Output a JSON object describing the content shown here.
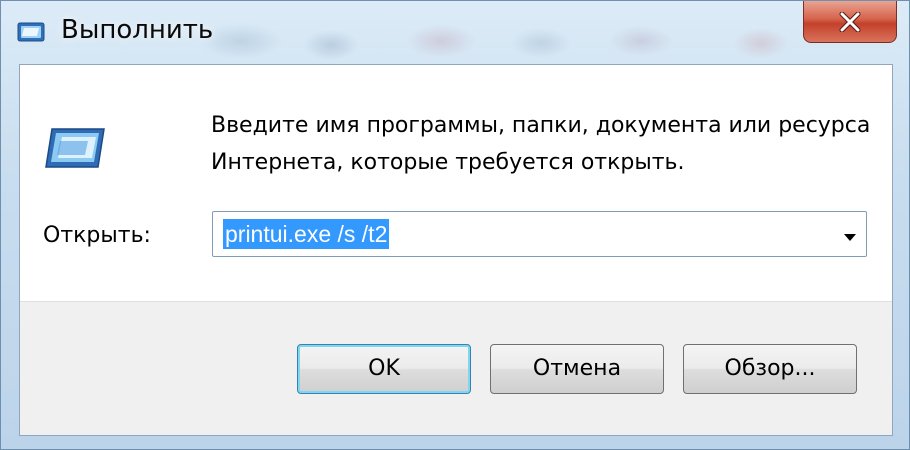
{
  "window": {
    "title": "Выполнить",
    "title_icon": "run-icon",
    "close_icon": "close-icon"
  },
  "dialog": {
    "icon": "run-icon",
    "prompt_lines": [
      "Введите имя программы, папки, документа или ресурса",
      "Интернета, которые требуется открыть."
    ],
    "open_label": "Открыть:",
    "open_value": "printui.exe /s /t2",
    "dropdown_icon": "chevron-down-icon"
  },
  "buttons": {
    "ok": "OK",
    "cancel": "Отмена",
    "browse": "Обзор..."
  },
  "colors": {
    "selection": "#3399ff",
    "close_button": "#c4402a",
    "default_button_glow": "#7fd6f0"
  }
}
